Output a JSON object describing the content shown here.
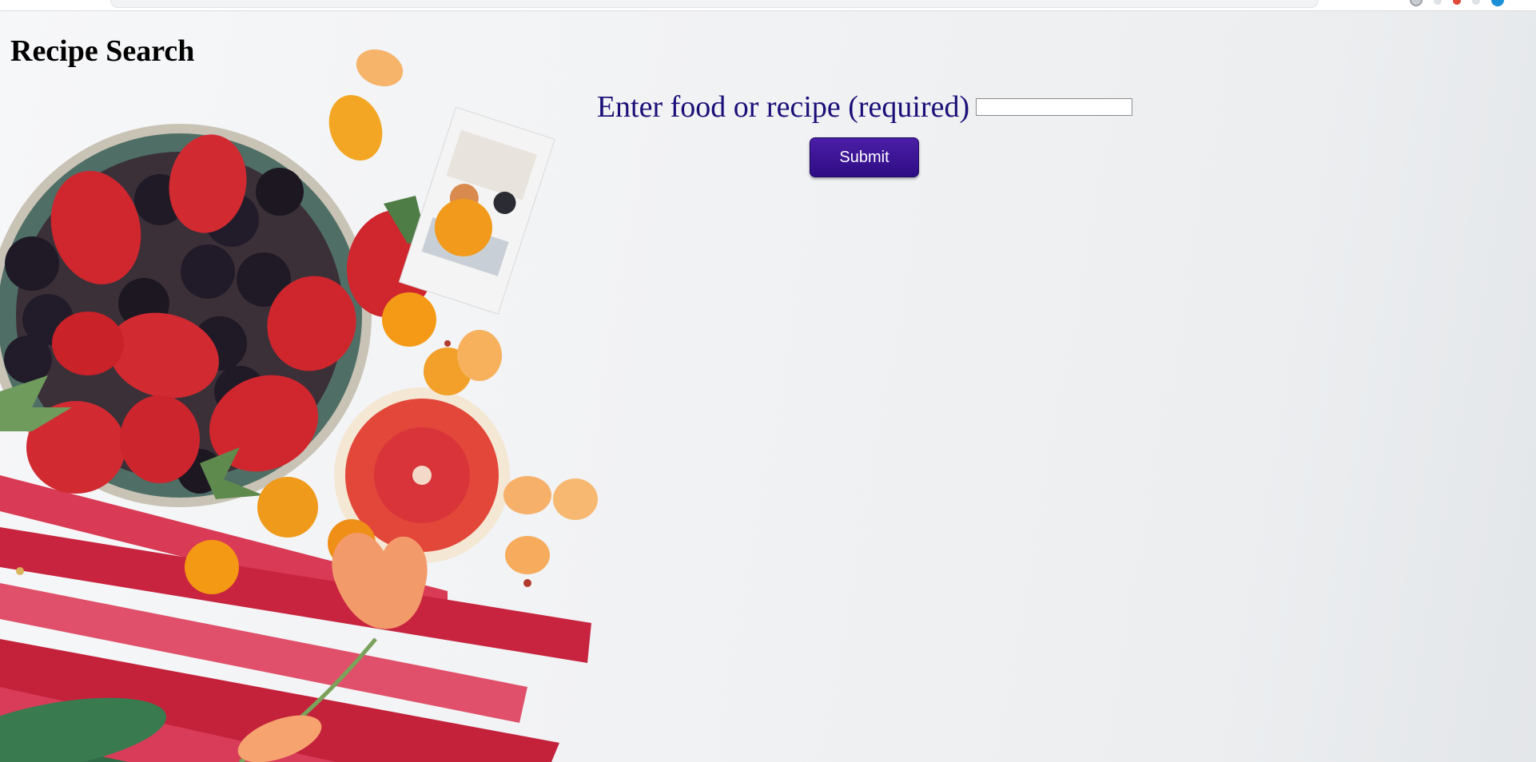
{
  "page": {
    "title": "Recipe Search"
  },
  "search": {
    "label": "Enter food or recipe (required)",
    "value": "",
    "placeholder": "",
    "submit_label": "Submit"
  },
  "colors": {
    "label": "#1a0f78",
    "button": "#3a1296",
    "background": "#f1f2f4"
  },
  "background_image": {
    "icon": "fruit-bowl-illustration"
  }
}
